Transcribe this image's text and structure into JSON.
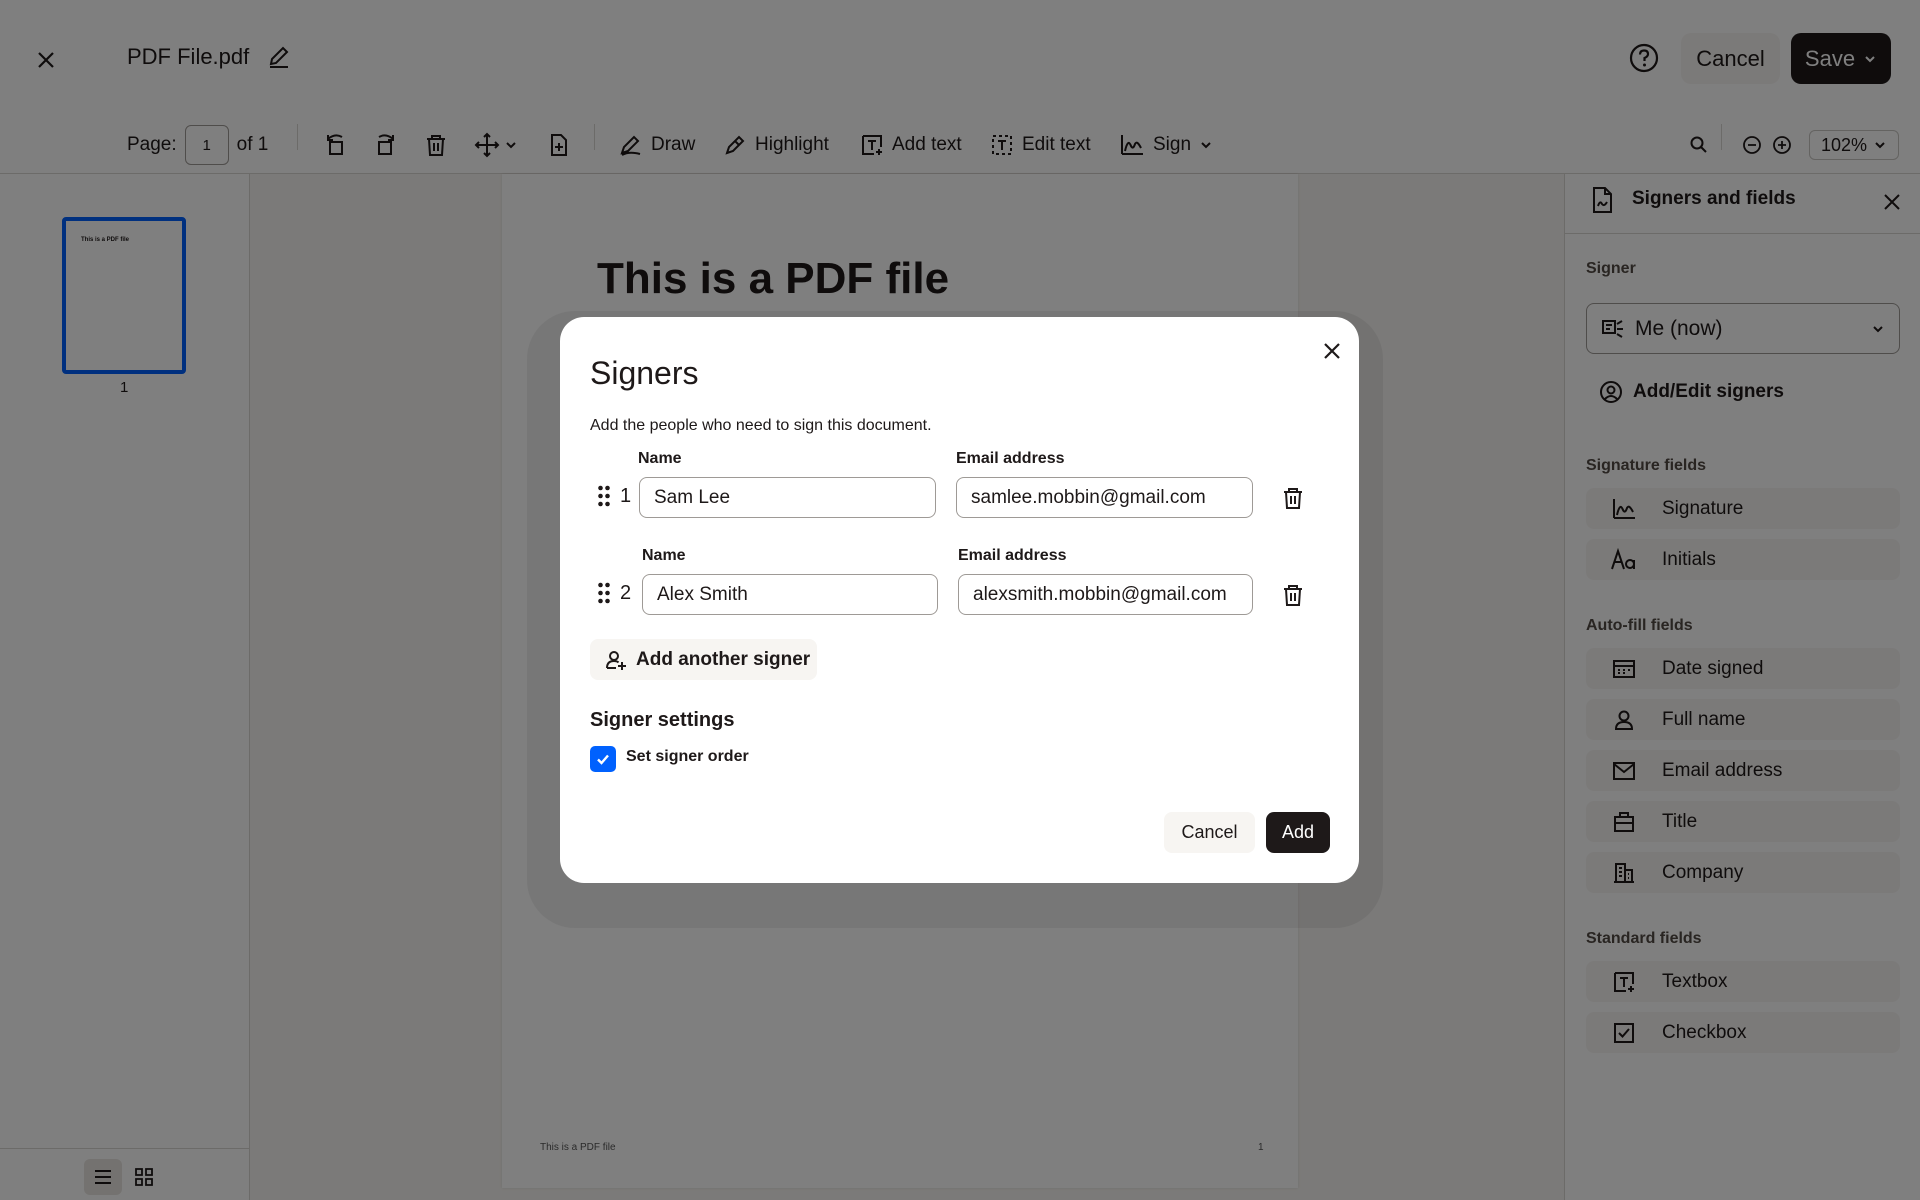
{
  "header": {
    "file_name": "PDF File.pdf",
    "cancel_label": "Cancel",
    "save_label": "Save"
  },
  "toolbar": {
    "page_label": "Page:",
    "page_value": "1",
    "page_of": "of 1",
    "draw": "Draw",
    "highlight": "Highlight",
    "add_text": "Add text",
    "edit_text": "Edit text",
    "sign": "Sign",
    "zoom": "102%"
  },
  "thumbnails": {
    "thumb_text": "This is a PDF file",
    "page_number": "1"
  },
  "document": {
    "title": "This is a PDF file",
    "footer_left": "This is a PDF file",
    "footer_right": "1"
  },
  "panel": {
    "title": "Signers and fields",
    "signer_label": "Signer",
    "signer_value": "Me (now)",
    "add_edit": "Add/Edit signers",
    "signature_fields_label": "Signature fields",
    "signature_fields": [
      {
        "label": "Signature",
        "icon": "signature-icon"
      },
      {
        "label": "Initials",
        "icon": "initials-icon"
      }
    ],
    "autofill_label": "Auto-fill fields",
    "autofill_fields": [
      {
        "label": "Date signed",
        "icon": "calendar-icon"
      },
      {
        "label": "Full name",
        "icon": "person-icon"
      },
      {
        "label": "Email address",
        "icon": "envelope-icon"
      },
      {
        "label": "Title",
        "icon": "briefcase-icon"
      },
      {
        "label": "Company",
        "icon": "building-icon"
      }
    ],
    "standard_label": "Standard fields",
    "standard_fields": [
      {
        "label": "Textbox",
        "icon": "textbox-icon"
      },
      {
        "label": "Checkbox",
        "icon": "checkbox-icon"
      }
    ]
  },
  "modal": {
    "title": "Signers",
    "description": "Add the people who need to sign this document.",
    "signers": [
      {
        "number": "1",
        "name_label": "Name",
        "name": "Sam Lee",
        "email_label": "Email address",
        "email": "samlee.mobbin@gmail.com"
      },
      {
        "number": "2",
        "name_label": "Name",
        "name": "Alex Smith",
        "email_label": "Email address",
        "email": "alexsmith.mobbin@gmail.com"
      }
    ],
    "add_another": "Add another signer",
    "settings_title": "Signer settings",
    "set_order_label": "Set signer order",
    "set_order_checked": true,
    "cancel": "Cancel",
    "add": "Add"
  },
  "colors": {
    "accent": "#0061fe",
    "dark": "#1e1919",
    "surface": "#f7f5f2"
  }
}
